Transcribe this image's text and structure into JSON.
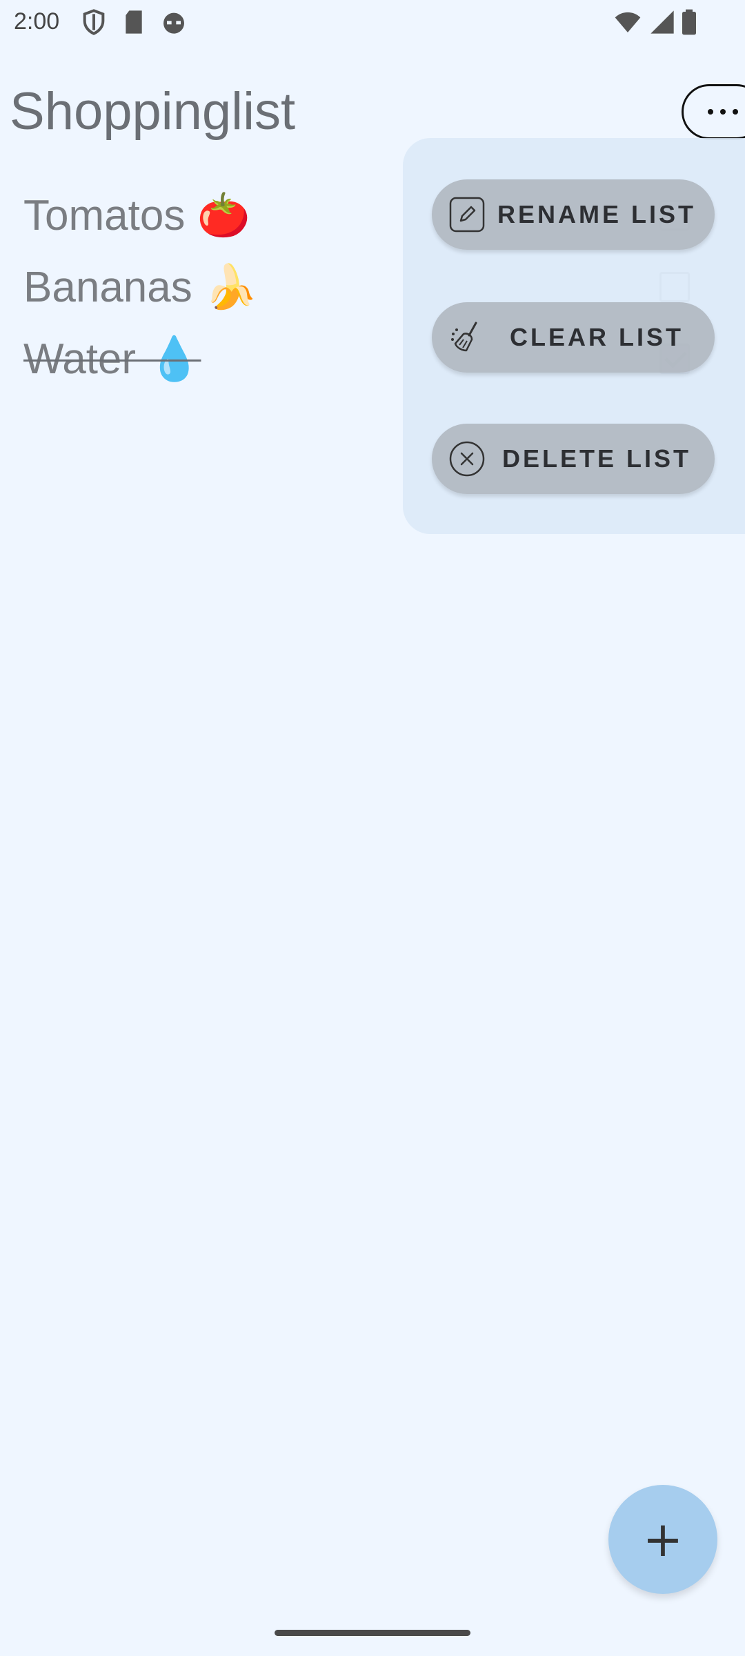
{
  "status_bar": {
    "time": "2:00",
    "icons": [
      "shield-icon",
      "sd-card-icon",
      "cat-face-icon",
      "wifi-icon",
      "signal-icon",
      "battery-icon"
    ]
  },
  "app_bar": {
    "title": "Shoppinglist",
    "more_icon": "more-horizontal-icon"
  },
  "items": [
    {
      "label": "Tomatos 🍅",
      "checked": false
    },
    {
      "label": "Bananas 🍌",
      "checked": false
    },
    {
      "label": "Water 💧",
      "checked": true
    }
  ],
  "menu": {
    "rename_label": "RENAME LIST",
    "clear_label": "CLEAR LIST",
    "delete_label": "DELETE LIST"
  },
  "fab": {
    "label": "+"
  },
  "colors": {
    "background": "#eff6ff",
    "menu_panel": "#dbe9f8",
    "menu_button": "#a5aab2",
    "fab": "#a6cdee"
  }
}
